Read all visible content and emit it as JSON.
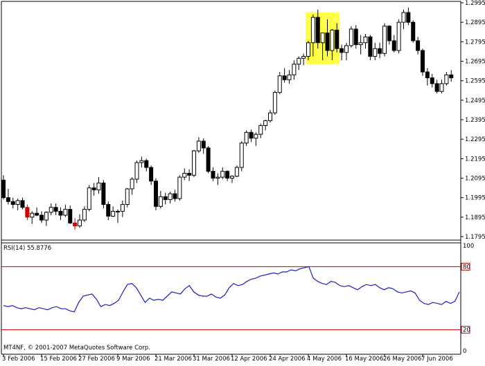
{
  "chart_data": [
    {
      "type": "candlestick",
      "price_axis": {
        "ylim": [
          1.1795,
          1.2995
        ],
        "ticks": [
          "1.2995",
          "1.2895",
          "1.2795",
          "1.2695",
          "1.2595",
          "1.2495",
          "1.2395",
          "1.2295",
          "1.2195",
          "1.2095",
          "1.1995",
          "1.1895",
          "1.1795"
        ]
      },
      "x_axis": {
        "tick_labels": [
          "3 Feb 2006",
          "15 Feb 2006",
          "27 Feb 2006",
          "9 Mar 2006",
          "21 Mar 2006",
          "31 Mar 2006",
          "12 Apr 2006",
          "24 Apr 2006",
          "4 May 2006",
          "16 May 2006",
          "26 May 2006",
          "7 Jun 2006"
        ],
        "tick_bar_index": [
          0,
          8,
          16,
          24,
          32,
          40,
          48,
          56,
          64,
          72,
          80,
          88
        ]
      },
      "bar_count": 95,
      "candles": [
        [
          1.2085,
          1.211,
          1.1985,
          1.1995
        ],
        [
          1.1995,
          1.204,
          1.196,
          1.1975
        ],
        [
          1.1975,
          1.1995,
          1.194,
          1.196
        ],
        [
          1.196,
          1.199,
          1.193,
          1.198
        ],
        [
          1.198,
          1.1995,
          1.1935,
          1.1945
        ],
        [
          1.1945,
          1.196,
          1.188,
          1.1895
        ],
        [
          1.1895,
          1.1925,
          1.186,
          1.1915
        ],
        [
          1.1915,
          1.1945,
          1.19,
          1.1905
        ],
        [
          1.1905,
          1.1925,
          1.1865,
          1.188
        ],
        [
          1.188,
          1.1925,
          1.185,
          1.192
        ],
        [
          1.192,
          1.1965,
          1.1905,
          1.1945
        ],
        [
          1.1945,
          1.1965,
          1.1905,
          1.1925
        ],
        [
          1.1925,
          1.1945,
          1.188,
          1.1905
        ],
        [
          1.1905,
          1.196,
          1.1895,
          1.1935
        ],
        [
          1.1935,
          1.1955,
          1.186,
          1.1865
        ],
        [
          1.1865,
          1.189,
          1.183,
          1.185
        ],
        [
          1.185,
          1.191,
          1.184,
          1.188
        ],
        [
          1.188,
          1.195,
          1.187,
          1.1935
        ],
        [
          1.1935,
          1.206,
          1.1925,
          1.2045
        ],
        [
          1.2045,
          1.207,
          1.2005,
          1.2035
        ],
        [
          1.2035,
          1.21,
          1.2015,
          1.207
        ],
        [
          1.207,
          1.2085,
          1.194,
          1.196
        ],
        [
          1.196,
          1.1975,
          1.188,
          1.19
        ],
        [
          1.19,
          1.195,
          1.1895,
          1.1925
        ],
        [
          1.1925,
          1.1935,
          1.1865,
          1.1925
        ],
        [
          1.1925,
          1.198,
          1.1895,
          1.196
        ],
        [
          1.196,
          1.2045,
          1.1945,
          1.204
        ],
        [
          1.204,
          1.21,
          1.201,
          1.209
        ],
        [
          1.209,
          1.2185,
          1.207,
          1.2175
        ],
        [
          1.2175,
          1.2205,
          1.215,
          1.2185
        ],
        [
          1.2185,
          1.2195,
          1.213,
          1.215
        ],
        [
          1.215,
          1.216,
          1.206,
          1.208
        ],
        [
          1.208,
          1.2095,
          1.193,
          1.195
        ],
        [
          1.195,
          1.203,
          1.194,
          1.2
        ],
        [
          1.2,
          1.202,
          1.196,
          1.1985
        ],
        [
          1.1985,
          1.2025,
          1.1965,
          1.2015
        ],
        [
          1.2015,
          1.2035,
          1.1975,
          1.199
        ],
        [
          1.199,
          1.211,
          1.198,
          1.21
        ],
        [
          1.21,
          1.2145,
          1.2085,
          1.212
        ],
        [
          1.212,
          1.214,
          1.208,
          1.211
        ],
        [
          1.211,
          1.224,
          1.21,
          1.2235
        ],
        [
          1.2235,
          1.2305,
          1.2225,
          1.2285
        ],
        [
          1.2285,
          1.23,
          1.222,
          1.225
        ],
        [
          1.225,
          1.226,
          1.212,
          1.213
        ],
        [
          1.213,
          1.215,
          1.208,
          1.2095
        ],
        [
          1.2095,
          1.212,
          1.206,
          1.21
        ],
        [
          1.21,
          1.215,
          1.209,
          1.213
        ],
        [
          1.213,
          1.2135,
          1.208,
          1.2095
        ],
        [
          1.2095,
          1.211,
          1.207,
          1.2105
        ],
        [
          1.2105,
          1.216,
          1.21,
          1.215
        ],
        [
          1.215,
          1.2285,
          1.213,
          1.2275
        ],
        [
          1.2275,
          1.234,
          1.226,
          1.233
        ],
        [
          1.233,
          1.2345,
          1.228,
          1.23
        ],
        [
          1.23,
          1.233,
          1.226,
          1.232
        ],
        [
          1.232,
          1.2375,
          1.23,
          1.2365
        ],
        [
          1.2365,
          1.2395,
          1.234,
          1.239
        ],
        [
          1.239,
          1.2445,
          1.238,
          1.243
        ],
        [
          1.243,
          1.2545,
          1.242,
          1.2535
        ],
        [
          1.2535,
          1.264,
          1.2525,
          1.262
        ],
        [
          1.262,
          1.266,
          1.2585,
          1.26
        ],
        [
          1.26,
          1.265,
          1.258,
          1.2625
        ],
        [
          1.2625,
          1.27,
          1.26,
          1.268
        ],
        [
          1.268,
          1.272,
          1.265,
          1.271
        ],
        [
          1.271,
          1.2735,
          1.2675,
          1.272
        ],
        [
          1.272,
          1.28,
          1.27,
          1.279
        ],
        [
          1.279,
          1.2935,
          1.272,
          1.292
        ],
        [
          1.292,
          1.296,
          1.276,
          1.279
        ],
        [
          1.279,
          1.284,
          1.27,
          1.284
        ],
        [
          1.284,
          1.291,
          1.272,
          1.275
        ],
        [
          1.275,
          1.286,
          1.27,
          1.2855
        ],
        [
          1.2855,
          1.289,
          1.274,
          1.276
        ],
        [
          1.276,
          1.278,
          1.27,
          1.274
        ],
        [
          1.274,
          1.279,
          1.27,
          1.2775
        ],
        [
          1.2775,
          1.2875,
          1.2765,
          1.286
        ],
        [
          1.286,
          1.288,
          1.276,
          1.278
        ],
        [
          1.278,
          1.283,
          1.273,
          1.279
        ],
        [
          1.279,
          1.2835,
          1.276,
          1.282
        ],
        [
          1.282,
          1.283,
          1.27,
          1.272
        ],
        [
          1.272,
          1.279,
          1.27,
          1.276
        ],
        [
          1.276,
          1.279,
          1.271,
          1.2735
        ],
        [
          1.2735,
          1.289,
          1.272,
          1.2875
        ],
        [
          1.2875,
          1.288,
          1.278,
          1.28
        ],
        [
          1.28,
          1.283,
          1.274,
          1.275
        ],
        [
          1.275,
          1.291,
          1.2735,
          1.2895
        ],
        [
          1.2895,
          1.296,
          1.286,
          1.2945
        ],
        [
          1.2945,
          1.297,
          1.288,
          1.2895
        ],
        [
          1.2895,
          1.2905,
          1.279,
          1.28
        ],
        [
          1.28,
          1.282,
          1.273,
          1.275
        ],
        [
          1.275,
          1.276,
          1.262,
          1.264
        ],
        [
          1.264,
          1.266,
          1.257,
          1.261
        ],
        [
          1.261,
          1.263,
          1.256,
          1.258
        ],
        [
          1.258,
          1.26,
          1.253,
          1.254
        ],
        [
          1.254,
          1.26,
          1.253,
          1.258
        ],
        [
          1.258,
          1.264,
          1.257,
          1.2625
        ],
        [
          1.2625,
          1.265,
          1.259,
          1.261
        ]
      ],
      "red_bars": [
        5,
        15
      ],
      "highlight": {
        "bars": [
          64,
          70
        ],
        "from": 1.268,
        "to": 1.2945
      }
    },
    {
      "type": "line",
      "indicator_label": "RSI(14) 55.8776",
      "ylim": [
        0,
        100
      ],
      "axis_ticks": [
        "100",
        "80",
        "20",
        "0"
      ],
      "levels": [
        80,
        20
      ],
      "values": [
        43,
        42,
        43,
        41,
        40,
        41,
        40,
        39,
        41,
        40,
        39,
        41,
        42,
        40,
        40,
        38,
        37,
        46,
        52,
        53,
        54,
        49,
        42,
        44,
        43,
        45,
        48,
        56,
        63,
        64,
        60,
        53,
        46,
        50,
        48,
        49,
        48,
        52,
        56,
        55,
        54,
        59,
        62,
        56,
        53,
        52,
        52,
        54,
        51,
        50,
        53,
        60,
        64,
        62,
        63,
        66,
        68,
        69,
        71,
        72,
        73,
        74,
        73,
        75,
        75,
        77,
        76,
        78,
        79,
        80,
        69,
        66,
        64,
        63,
        66,
        65,
        62,
        61,
        62,
        60,
        58,
        61,
        63,
        62,
        63,
        60,
        58,
        60,
        59,
        56,
        55,
        56,
        57,
        55,
        48,
        45,
        44,
        46,
        45,
        44,
        47,
        45,
        47,
        56
      ],
      "line_color": "#1a1ac8",
      "level_color": "#cc0000"
    }
  ],
  "footer": {
    "copyright": "MT4NF, © 2001-2007 MetaQuotes Software Corp."
  }
}
